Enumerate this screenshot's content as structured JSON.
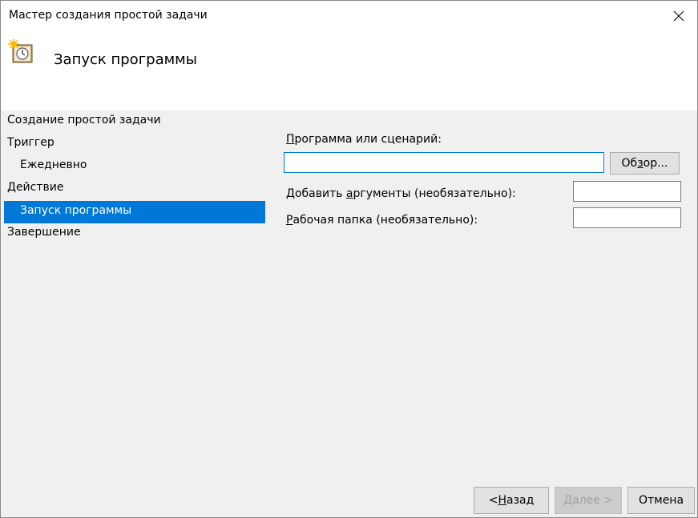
{
  "window": {
    "title": "Мастер создания простой задачи"
  },
  "header": {
    "title": "Запуск программы",
    "icon": "task-scheduler-clock-icon"
  },
  "nav": {
    "items": [
      {
        "label": "Создание простой задачи",
        "indent": false,
        "selected": false
      },
      {
        "label": "Триггер",
        "indent": false,
        "selected": false
      },
      {
        "label": "Ежедневно",
        "indent": true,
        "selected": false
      },
      {
        "label": "Действие",
        "indent": false,
        "selected": false
      },
      {
        "label": "Запуск программы",
        "indent": true,
        "selected": true
      },
      {
        "label": "Завершение",
        "indent": false,
        "selected": false
      }
    ]
  },
  "form": {
    "program_label_pre": "",
    "program_label_ul": "П",
    "program_label_post": "рограмма или сценарий:",
    "program_value": "",
    "browse_label_pre": "Об",
    "browse_label_ul": "з",
    "browse_label_post": "ор...",
    "args_label_pre": "Добавить ",
    "args_label_ul": "а",
    "args_label_post": "ргументы (необязательно):",
    "args_value": "",
    "folder_label_pre": "",
    "folder_label_ul": "Р",
    "folder_label_post": "абочая папка (необязательно):",
    "folder_value": ""
  },
  "footer": {
    "back_label_pre": "< ",
    "back_label_ul": "Н",
    "back_label_post": "азад",
    "next_label_pre": "",
    "next_label_ul": "Д",
    "next_label_post": "алее >",
    "cancel_label": "Отмена"
  },
  "colors": {
    "accent": "#0078d7",
    "background": "#f0f0f0"
  }
}
